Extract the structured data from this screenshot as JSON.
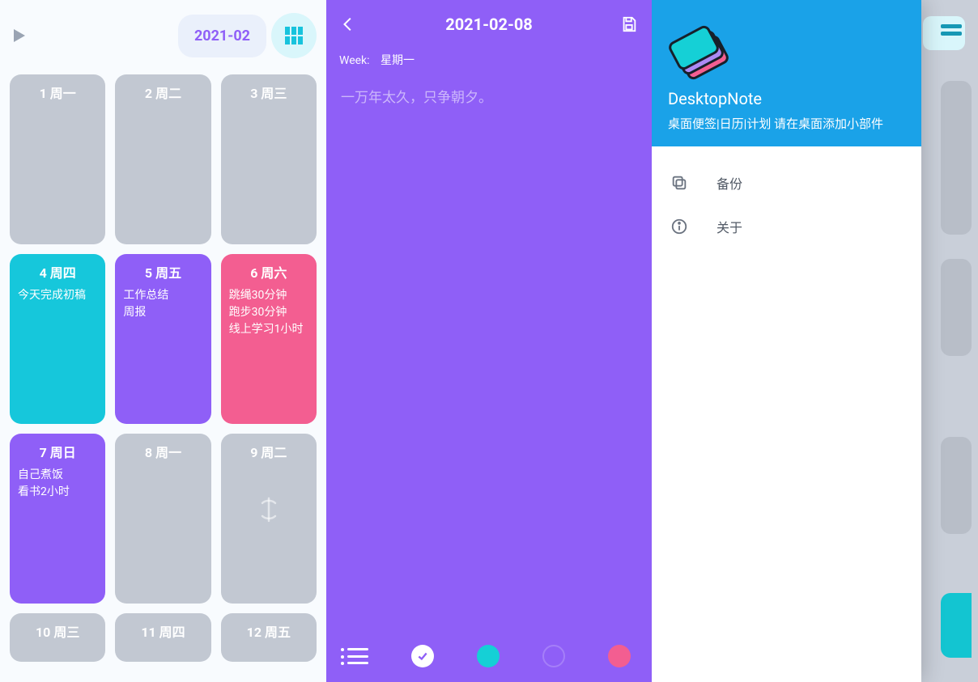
{
  "panel1": {
    "month_label": "2021-02",
    "cards": [
      {
        "num": "1",
        "dow": "周一",
        "color": "gray",
        "lines": []
      },
      {
        "num": "2",
        "dow": "周二",
        "color": "gray",
        "lines": []
      },
      {
        "num": "3",
        "dow": "周三",
        "color": "gray",
        "lines": []
      },
      {
        "num": "4",
        "dow": "周四",
        "color": "cyan",
        "lines": [
          "今天完成初稿"
        ]
      },
      {
        "num": "5",
        "dow": "周五",
        "color": "purple",
        "lines": [
          "工作总结",
          "周报"
        ]
      },
      {
        "num": "6",
        "dow": "周六",
        "color": "pink",
        "lines": [
          "跳绳30分钟",
          "跑步30分钟",
          "线上学习1小时"
        ]
      },
      {
        "num": "7",
        "dow": "周日",
        "color": "purple",
        "lines": [
          "自己煮饭",
          "看书2小时"
        ]
      },
      {
        "num": "8",
        "dow": "周一",
        "color": "gray",
        "lines": []
      },
      {
        "num": "9",
        "dow": "周二",
        "color": "gray",
        "lines": [],
        "today": true
      },
      {
        "num": "10",
        "dow": "周三",
        "color": "gray",
        "lines": []
      },
      {
        "num": "11",
        "dow": "周四",
        "color": "gray",
        "lines": []
      },
      {
        "num": "12",
        "dow": "周五",
        "color": "gray",
        "lines": []
      }
    ]
  },
  "panel2": {
    "title": "2021-02-08",
    "week_label": "Week:",
    "week_value": "星期一",
    "placeholder": "一万年太久，只争朝夕。"
  },
  "panel3": {
    "app_name": "DesktopNote",
    "subtitle": "桌面便签|日历|计划  请在桌面添加小部件",
    "menu": [
      {
        "icon": "copy-icon",
        "label": "备份"
      },
      {
        "icon": "info-icon",
        "label": "关于"
      }
    ]
  }
}
